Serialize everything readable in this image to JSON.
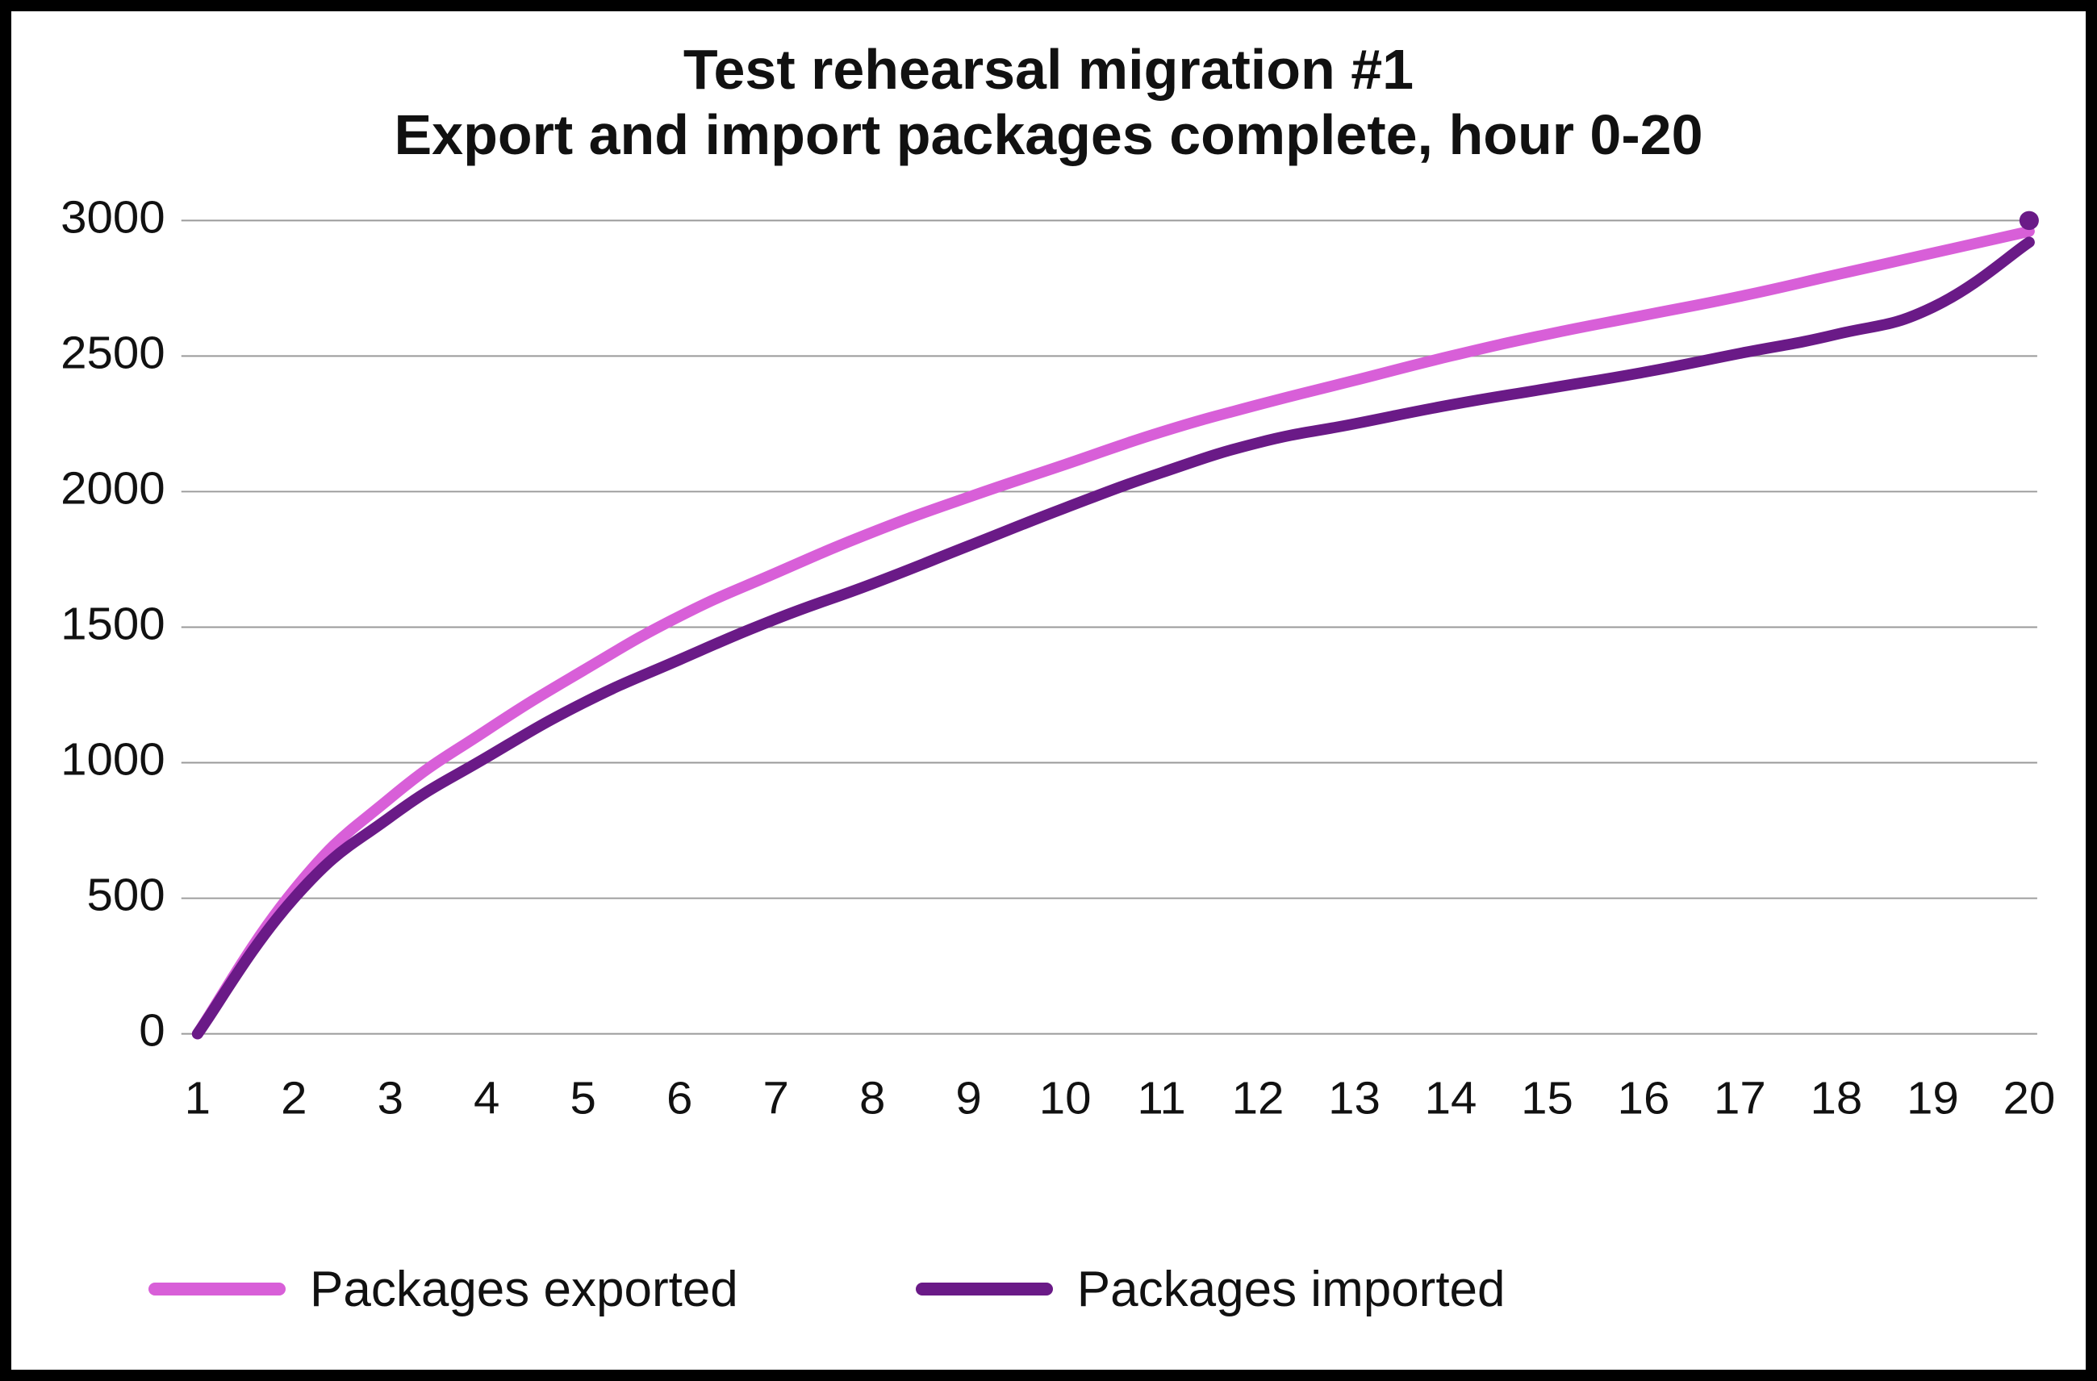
{
  "chart_data": {
    "type": "line",
    "title_line1": "Test rehearsal migration #1",
    "title_line2": "Export and import packages complete, hour 0-20",
    "xlabel": "",
    "ylabel": "",
    "categories": [
      "1",
      "2",
      "3",
      "4",
      "5",
      "6",
      "7",
      "8",
      "9",
      "10",
      "11",
      "12",
      "13",
      "14",
      "15",
      "16",
      "17",
      "18",
      "19",
      "20"
    ],
    "y_ticks": [
      0,
      500,
      1000,
      1500,
      2000,
      2500,
      3000
    ],
    "ylim": [
      0,
      3000
    ],
    "series": [
      {
        "name": "Packages exported",
        "color": "#d85fd8",
        "values": [
          0,
          530,
          870,
          1120,
          1340,
          1540,
          1700,
          1850,
          1980,
          2100,
          2220,
          2320,
          2410,
          2500,
          2580,
          2650,
          2720,
          2800,
          2880,
          2960
        ]
      },
      {
        "name": "Packages imported",
        "color": "#6a1a87",
        "values": [
          0,
          500,
          800,
          1020,
          1220,
          1380,
          1530,
          1660,
          1800,
          1940,
          2070,
          2180,
          2250,
          2320,
          2380,
          2440,
          2510,
          2580,
          2680,
          2920
        ]
      }
    ],
    "end_marker": {
      "x_index": 19,
      "y": 3000,
      "color": "#6a1a87"
    },
    "legend": [
      {
        "label": "Packages exported",
        "color": "#d85fd8"
      },
      {
        "label": "Packages imported",
        "color": "#6a1a87"
      }
    ]
  }
}
